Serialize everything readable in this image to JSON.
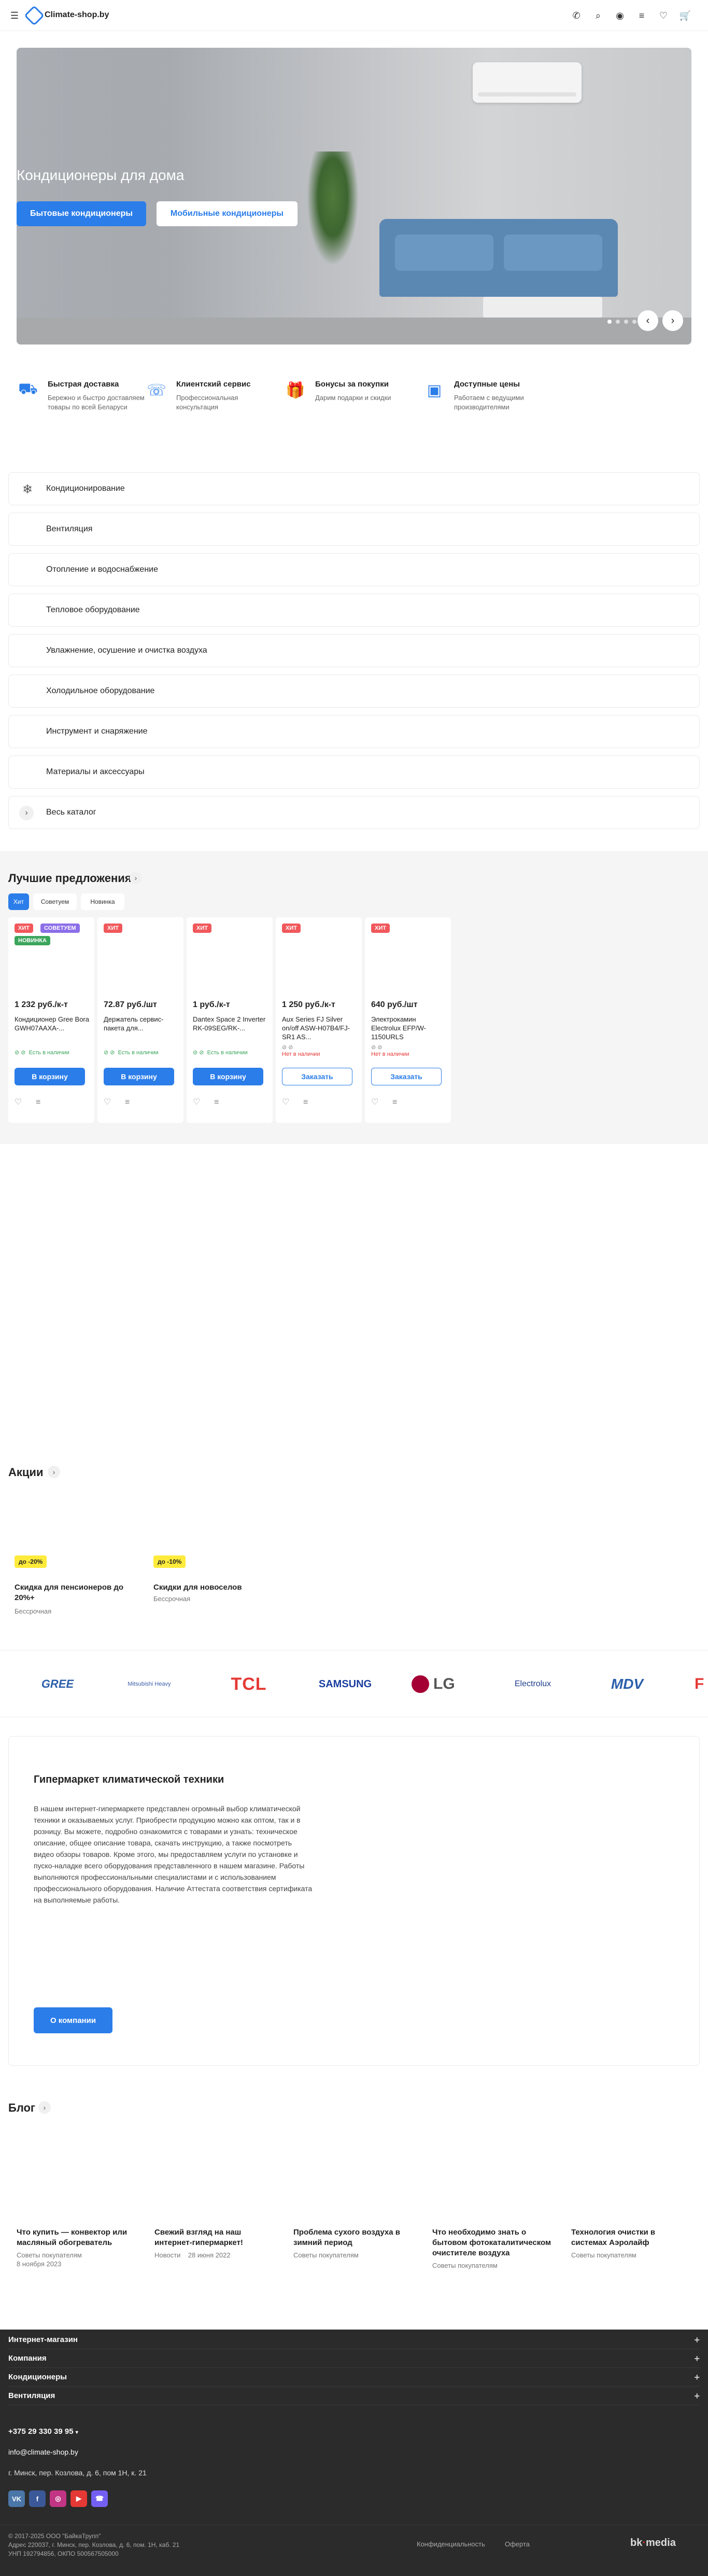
{
  "header": {
    "logo_text": "Climate-shop.by",
    "icons": [
      "menu-icon",
      "phone-icon",
      "search-icon",
      "user-icon",
      "compare-icon",
      "heart-icon",
      "cart-icon"
    ]
  },
  "hero": {
    "title": "Кондиционеры для дома",
    "button_primary": "Бытовые кондиционеры",
    "button_secondary": "Мобильные кондиционеры",
    "slide_count": 4,
    "active_slide": 1
  },
  "features": [
    {
      "icon": "truck-icon",
      "title": "Быстрая доставка",
      "desc": "Бережно и быстро доставляем товары по всей Беларуси"
    },
    {
      "icon": "support-icon",
      "title": "Клиентский сервис",
      "desc": "Профессиональная консультация"
    },
    {
      "icon": "gift-icon",
      "title": "Бонусы за покупки",
      "desc": "Дарим подарки и скидки"
    },
    {
      "icon": "wallet-icon",
      "title": "Доступные цены",
      "desc": "Работаем с ведущими производителями"
    }
  ],
  "categories": [
    {
      "label": "Кондиционирование"
    },
    {
      "label": "Вентиляция"
    },
    {
      "label": "Отопление и водоснабжение"
    },
    {
      "label": "Тепловое оборудование"
    },
    {
      "label": "Увлажнение, осушение и очистка воздуха"
    },
    {
      "label": "Холодильное оборудование"
    },
    {
      "label": "Инструмент и снаряжение"
    },
    {
      "label": "Материалы и аксессуары"
    },
    {
      "label": "Весь каталог"
    }
  ],
  "offers": {
    "title": "Лучшие предложения",
    "tabs": [
      "Хит",
      "Советуем",
      "Новинка"
    ],
    "active_tab": 0,
    "cards": [
      {
        "badges": [
          "ХИТ",
          "СОВЕТУЕМ",
          "НОВИНКА"
        ],
        "price": "1 232 руб./к-т",
        "name": "Кондиционер Gree Bora GWH07AAXA-...",
        "stock": "Есть в наличии",
        "stock_color": "#3ba55c",
        "button": "В корзину",
        "button_style": "fill"
      },
      {
        "badges": [
          "ХИТ"
        ],
        "price": "72.87 руб./шт",
        "name": "Держатель сервис-пакета для...",
        "stock": "Есть в наличии",
        "stock_color": "#3ba55c",
        "button": "В корзину",
        "button_style": "fill"
      },
      {
        "badges": [
          "ХИТ"
        ],
        "price": "1 руб./к-т",
        "name": "Dantex Space 2 Inverter RK-09SEG/RK-...",
        "stock": "Есть в наличии",
        "stock_color": "#3ba55c",
        "button": "В корзину",
        "button_style": "fill"
      },
      {
        "badges": [
          "ХИТ"
        ],
        "price": "1 250 руб./к-т",
        "name": "Aux Series FJ Silver on/off ASW-H07B4/FJ-SR1 AS...",
        "stock": "Нет в наличии",
        "stock_color": "#e53935",
        "button": "Заказать",
        "button_style": "outline"
      },
      {
        "badges": [
          "ХИТ"
        ],
        "price": "640 руб./шт",
        "name": "Электрокамин Electrolux EFP/W-1150URLS",
        "stock": "Нет в наличии",
        "stock_color": "#e53935",
        "button": "Заказать",
        "button_style": "outline"
      }
    ]
  },
  "promos": {
    "title": "Акции",
    "items": [
      {
        "badge": "до -20%",
        "title": "Скидка для пенсионеров до 20%+",
        "period": "Бессрочная"
      },
      {
        "badge": "до -10%",
        "title": "Скидки для новоселов",
        "period": "Бессрочная"
      }
    ]
  },
  "brands": [
    "GREE",
    "Mitsubishi Heavy",
    "TCL",
    "SAMSUNG",
    "LG",
    "Electrolux",
    "MDV",
    "F"
  ],
  "about": {
    "title": "Гипермаркет климатической техники",
    "text": "В нашем интернет-гипермаркете представлен огромный выбор климатической техники и оказываемых услуг. Приобрести продукцию можно как оптом, так и в розницу. Вы можете, подробно ознакомится с товарами и узнать: техническое описание, общее описание товара, скачать инструкцию, а также посмотреть видео обзоры товаров. Кроме этого, мы предоставляем услуги по установке и пуско-наладке всего оборудования представленного в нашем магазине. Работы выполняются профессиональными специалистами и с использованием профессионального оборудования. Наличие Аттестата соответствия сертификата на выполняемые работы.",
    "button": "О компании"
  },
  "blog": {
    "title": "Блог",
    "posts": [
      {
        "title": "Что купить — конвектор или масляный обогреватель",
        "category": "Советы покупателям",
        "date": "8 ноября 2023"
      },
      {
        "title": "Свежий взгляд на наш интернет-гипермаркет!",
        "category": "Новости",
        "date": "28 июня 2022"
      },
      {
        "title": "Проблема сухого воздуха в зимний период",
        "category": "Советы покупателям",
        "date": ""
      },
      {
        "title": "Что необходимо знать о бытовом фотокаталитическом очистителе воздуха",
        "category": "Советы покупателям",
        "date": ""
      },
      {
        "title": "Технология очистки в системах Аэролайф",
        "category": "Советы покупателям",
        "date": ""
      }
    ]
  },
  "footer": {
    "nav": [
      "Интернет-магазин",
      "Компания",
      "Кондиционеры",
      "Вентиляция"
    ],
    "phone": "+375 29 330 39 95",
    "email": "info@climate-shop.by",
    "address": "г. Минск, пер. Козлова, д. 6, пом 1Н, к. 21",
    "social": [
      {
        "name": "vk-icon",
        "label": "VK",
        "color": "#4a76a8"
      },
      {
        "name": "facebook-icon",
        "label": "f",
        "color": "#3b5998"
      },
      {
        "name": "instagram-icon",
        "label": "◎",
        "color": "#c13584"
      },
      {
        "name": "youtube-icon",
        "label": "▶",
        "color": "#e53935"
      },
      {
        "name": "viber-icon",
        "label": "☎",
        "color": "#7360f2"
      }
    ],
    "copyright": "© 2017-2025 ООО \"БайкаТрупп\"",
    "legal_address": "Адрес 220037, г. Минск, пер. Козлова, д. 6, пом. 1Н, каб. 21",
    "unp": "УНП 192794856, ОКПО 500567505000",
    "links": [
      "Конфиденциальность",
      "Оферта"
    ],
    "dev_logo": "bk media"
  }
}
